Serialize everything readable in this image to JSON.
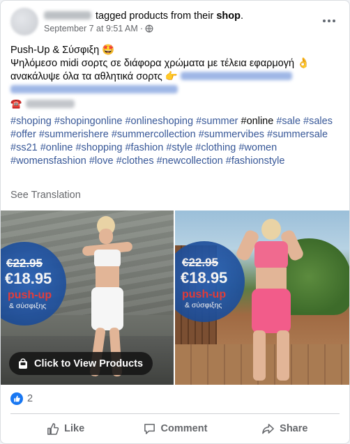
{
  "post": {
    "author_suffix": "tagged products from their",
    "shop_link": "shop",
    "period": ".",
    "timestamp": "September 7 at 9:51 AM",
    "separator": "·",
    "audience_icon": "globe-icon",
    "more_icon": "more-options-icon"
  },
  "body": {
    "headline": "Push-Up & Σύσφιξη 🤩",
    "line2": "Ψηλόμεσο midi σορτς σε διάφορα χρώματα με τέλεια εφαρμογή 👌",
    "line3": "ανακάλυψε όλα τα αθλητικά σορτς 👉",
    "phone_icon": "☎️"
  },
  "hashtags": [
    {
      "text": "#shoping",
      "link": true
    },
    {
      "text": "#shopingonline",
      "link": true
    },
    {
      "text": "#onlineshoping",
      "link": true
    },
    {
      "text": "#summer",
      "link": true
    },
    {
      "text": "#online",
      "link": false
    },
    {
      "text": "#sale",
      "link": true
    },
    {
      "text": "#sales",
      "link": true
    },
    {
      "text": "#offer",
      "link": true
    },
    {
      "text": "#summerishere",
      "link": true
    },
    {
      "text": "#summercollection",
      "link": true
    },
    {
      "text": "#summervibes",
      "link": true
    },
    {
      "text": "#summersale",
      "link": true
    },
    {
      "text": "#ss21",
      "link": true
    },
    {
      "text": "#online",
      "link": true
    },
    {
      "text": "#shopping",
      "link": true
    },
    {
      "text": "#fashion",
      "link": true
    },
    {
      "text": "#style",
      "link": true
    },
    {
      "text": "#clothing",
      "link": true
    },
    {
      "text": "#women",
      "link": true
    },
    {
      "text": "#womensfashion",
      "link": true
    },
    {
      "text": "#love",
      "link": true
    },
    {
      "text": "#clothes",
      "link": true
    },
    {
      "text": "#newcollection",
      "link": true
    },
    {
      "text": "#fashionstyle",
      "link": true
    }
  ],
  "see_translation": "See Translation",
  "products": [
    {
      "old_price": "€22.95",
      "new_price": "€18.95",
      "promo": "push-up",
      "promo_sub": "& σύσφιξης",
      "color": "white"
    },
    {
      "old_price": "€22.95",
      "new_price": "€18.95",
      "promo": "push-up",
      "promo_sub": "& σύσφιξης",
      "color": "#f25c8a"
    }
  ],
  "view_products_label": "Click to View Products",
  "reactions": {
    "icon": "like-reaction-icon",
    "count": "2"
  },
  "actions": {
    "like": "Like",
    "comment": "Comment",
    "share": "Share"
  },
  "colors": {
    "link": "#385898",
    "facebook_blue": "#1877f2",
    "muted": "#65676b",
    "promo_red": "#e93a3a",
    "badge_blue": "#1d4c96"
  }
}
